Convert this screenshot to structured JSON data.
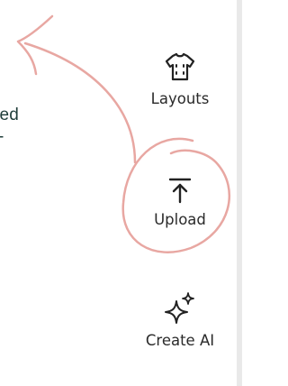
{
  "canvas_partial": {
    "line1": "ted",
    "line2": "-"
  },
  "tools": [
    {
      "label": "Layouts",
      "icon": "tshirt-icon"
    },
    {
      "label": "Upload",
      "icon": "upload-icon"
    },
    {
      "label": "Create AI",
      "icon": "sparkles-icon"
    }
  ],
  "colors": {
    "annotation": "#e8a7a2",
    "text_dark": "#1f3d3a",
    "rail": "#e9e9e9"
  }
}
